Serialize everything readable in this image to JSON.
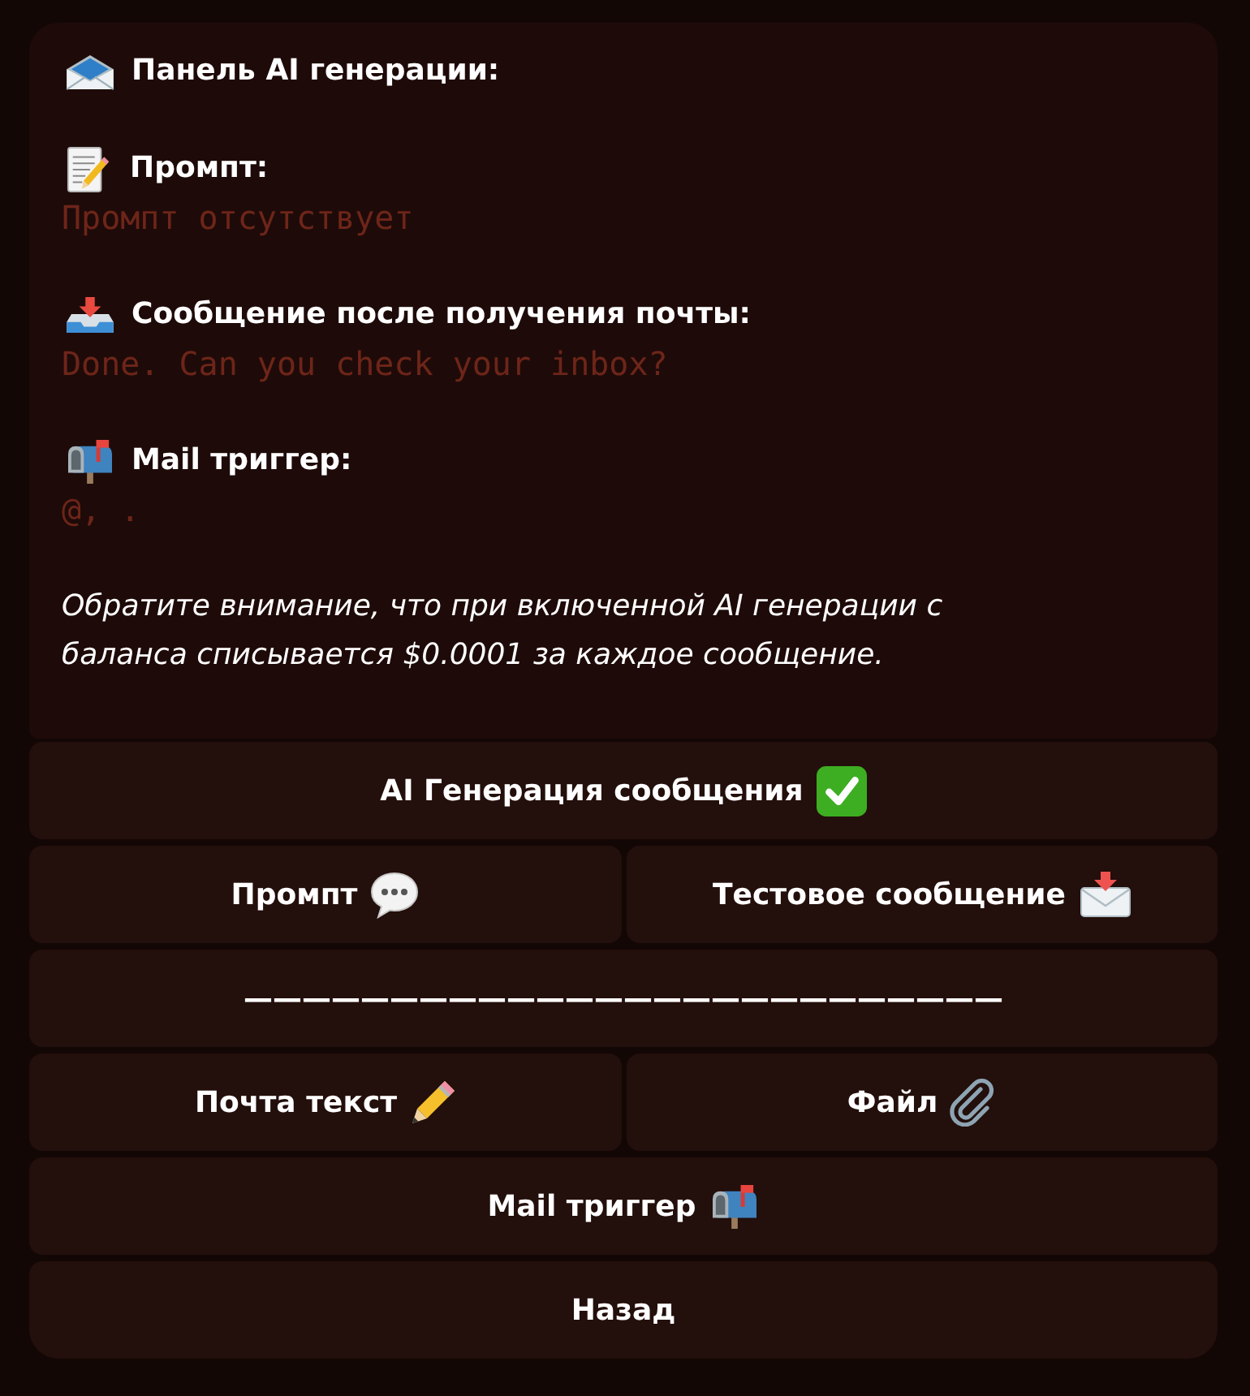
{
  "message": {
    "title": "Панель AI генерации:",
    "fields": [
      {
        "label": "Промпт:",
        "value": "Промпт отсутствует"
      },
      {
        "label": "Сообщение после получения почты:",
        "value": "Done. Can you check your inbox?"
      },
      {
        "label": "Mail триггер:",
        "value": "@, ."
      }
    ],
    "note": "Обратите внимание, что при включенной AI генерации с баланса списывается $0.0001 за каждое сообщение."
  },
  "keyboard_rows": [
    [
      {
        "kind": "toggle",
        "label": "AI Генерация сообщения",
        "on": true
      }
    ],
    [
      {
        "kind": "button",
        "label": "Промпт"
      },
      {
        "kind": "button",
        "label": "Тестовое сообщение"
      }
    ],
    [
      {
        "kind": "divider",
        "label": "——————————————————————————"
      }
    ],
    [
      {
        "kind": "button",
        "label": "Почта текст"
      },
      {
        "kind": "button",
        "label": "Файл"
      }
    ],
    [
      {
        "kind": "button",
        "label": "Mail триггер"
      }
    ],
    [
      {
        "kind": "button",
        "label": "Назад"
      }
    ]
  ]
}
